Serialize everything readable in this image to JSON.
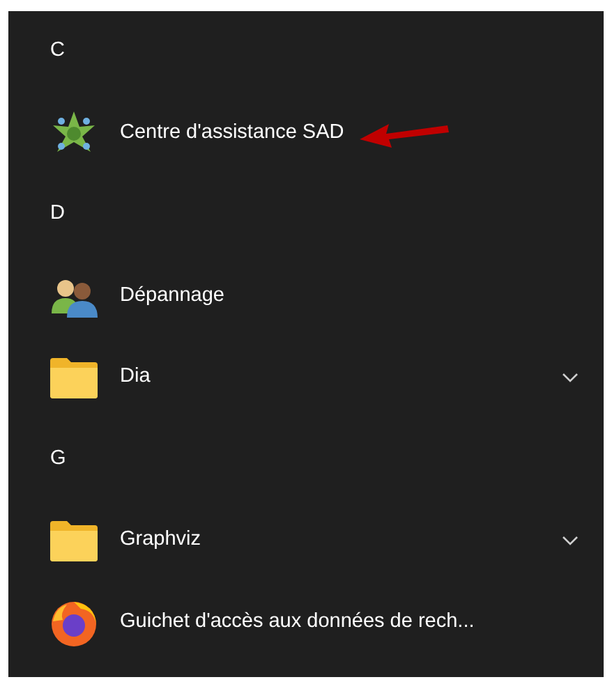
{
  "items": [
    {
      "kind": "header",
      "label": "C"
    },
    {
      "kind": "app",
      "label": "Centre d'assistance SAD",
      "expandable": false,
      "marked": true
    },
    {
      "kind": "header",
      "label": "D"
    },
    {
      "kind": "app",
      "label": "Dépannage",
      "expandable": false,
      "marked": false
    },
    {
      "kind": "folder",
      "label": "Dia",
      "expandable": true,
      "marked": false
    },
    {
      "kind": "header",
      "label": "G"
    },
    {
      "kind": "folder",
      "label": "Graphviz",
      "expandable": true,
      "marked": false
    },
    {
      "kind": "app",
      "label": "Guichet d'accès aux données de rech...",
      "expandable": false,
      "marked": false
    }
  ]
}
